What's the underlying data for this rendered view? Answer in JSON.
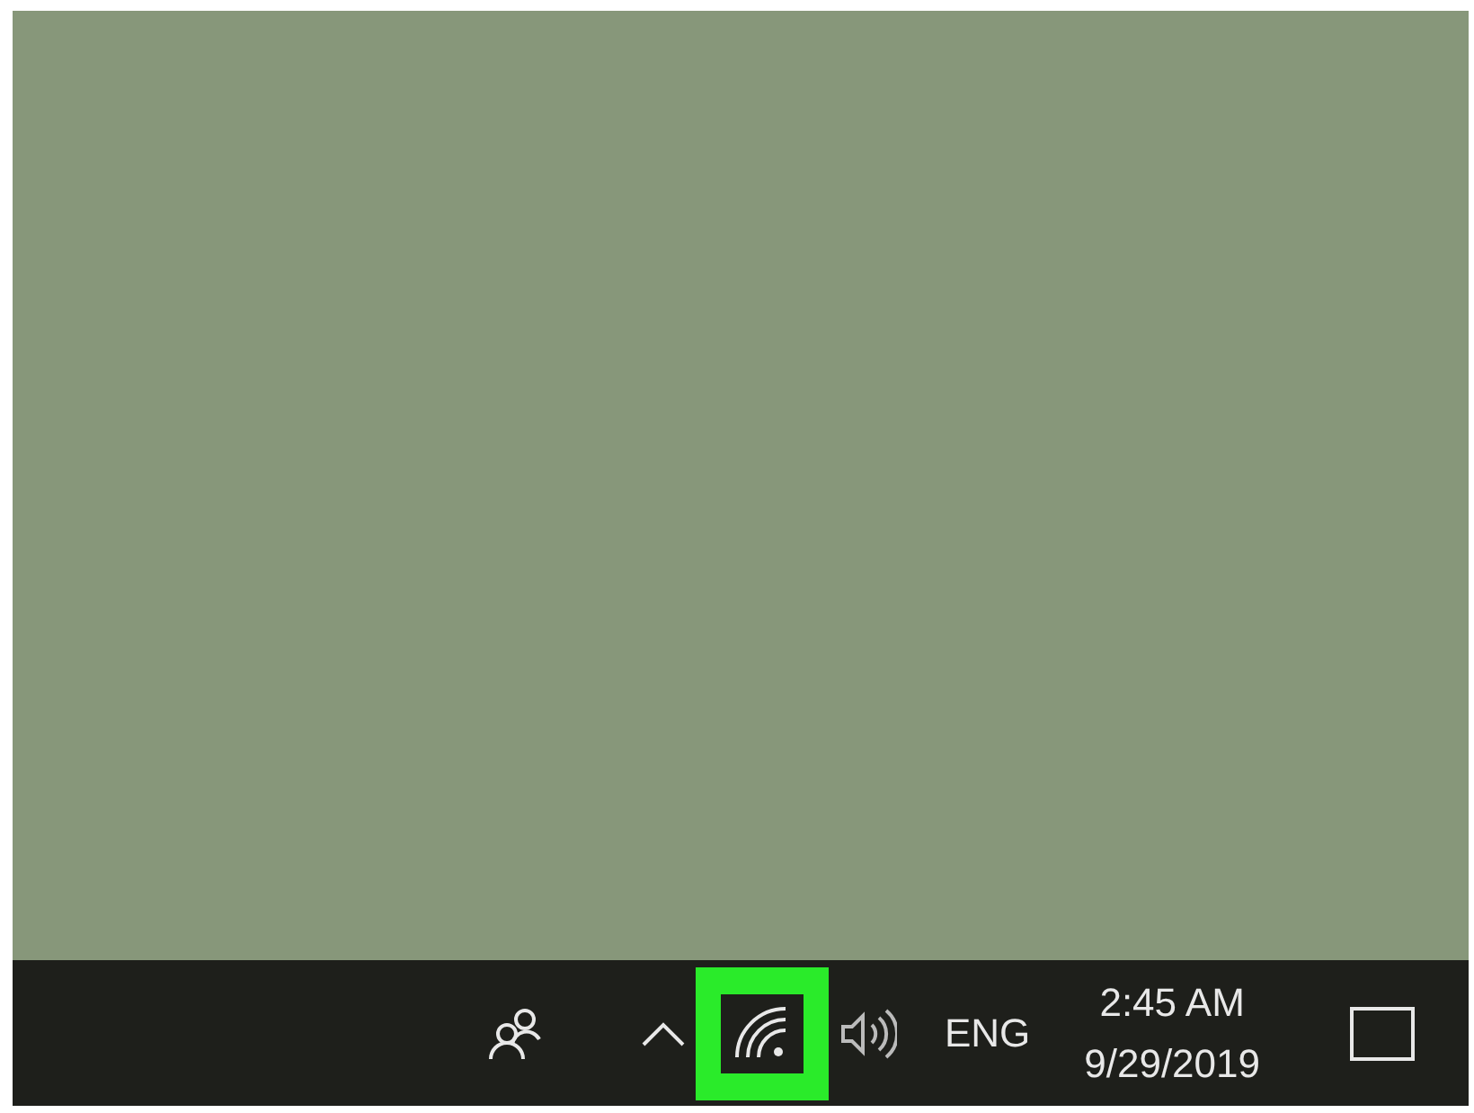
{
  "taskbar": {
    "tray": [
      {
        "kind": "people",
        "highlighted": false
      },
      {
        "kind": "chevron",
        "highlighted": false
      },
      {
        "kind": "wifi",
        "highlighted": true
      },
      {
        "kind": "volume",
        "highlighted": false
      }
    ],
    "language": "ENG",
    "clock": {
      "time": "2:45 AM",
      "date": "9/29/2019"
    }
  }
}
